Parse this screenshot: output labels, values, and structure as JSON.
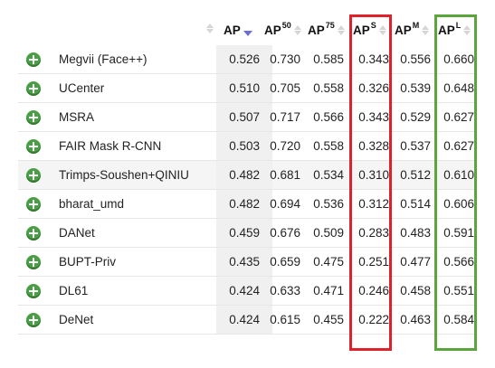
{
  "header": {
    "columns": [
      {
        "base": "AP",
        "sup": ""
      },
      {
        "base": "AP",
        "sup": "50"
      },
      {
        "base": "AP",
        "sup": "75"
      },
      {
        "base": "AP",
        "sup": "S"
      },
      {
        "base": "AP",
        "sup": "M"
      },
      {
        "base": "AP",
        "sup": "L"
      }
    ],
    "sorted_column": "AP",
    "sort_direction": "descending"
  },
  "highlight": {
    "red_column": "APS",
    "green_column": "APL",
    "red_color": "#e0202a",
    "green_color": "#5aa63d"
  },
  "accent": {
    "plus_icon_color": "#4a9e45",
    "active_sort_color": "#6a6fd3"
  },
  "rows": [
    {
      "team": "Megvii (Face++)",
      "ap": "0.526",
      "ap50": "0.730",
      "ap75": "0.585",
      "aps": "0.343",
      "apm": "0.556",
      "apl": "0.660"
    },
    {
      "team": "UCenter",
      "ap": "0.510",
      "ap50": "0.705",
      "ap75": "0.558",
      "aps": "0.326",
      "apm": "0.539",
      "apl": "0.648"
    },
    {
      "team": "MSRA",
      "ap": "0.507",
      "ap50": "0.717",
      "ap75": "0.566",
      "aps": "0.343",
      "apm": "0.529",
      "apl": "0.627"
    },
    {
      "team": "FAIR Mask R-CNN",
      "ap": "0.503",
      "ap50": "0.720",
      "ap75": "0.558",
      "aps": "0.328",
      "apm": "0.537",
      "apl": "0.627"
    },
    {
      "team": "Trimps-Soushen+QINIU",
      "ap": "0.482",
      "ap50": "0.681",
      "ap75": "0.534",
      "aps": "0.310",
      "apm": "0.512",
      "apl": "0.610"
    },
    {
      "team": "bharat_umd",
      "ap": "0.482",
      "ap50": "0.694",
      "ap75": "0.536",
      "aps": "0.312",
      "apm": "0.514",
      "apl": "0.606"
    },
    {
      "team": "DANet",
      "ap": "0.459",
      "ap50": "0.676",
      "ap75": "0.509",
      "aps": "0.283",
      "apm": "0.483",
      "apl": "0.591"
    },
    {
      "team": "BUPT-Priv",
      "ap": "0.435",
      "ap50": "0.659",
      "ap75": "0.475",
      "aps": "0.251",
      "apm": "0.477",
      "apl": "0.566"
    },
    {
      "team": "DL61",
      "ap": "0.424",
      "ap50": "0.633",
      "ap75": "0.471",
      "aps": "0.246",
      "apm": "0.458",
      "apl": "0.551"
    },
    {
      "team": "DeNet",
      "ap": "0.424",
      "ap50": "0.615",
      "ap75": "0.455",
      "aps": "0.222",
      "apm": "0.463",
      "apl": "0.584"
    }
  ]
}
